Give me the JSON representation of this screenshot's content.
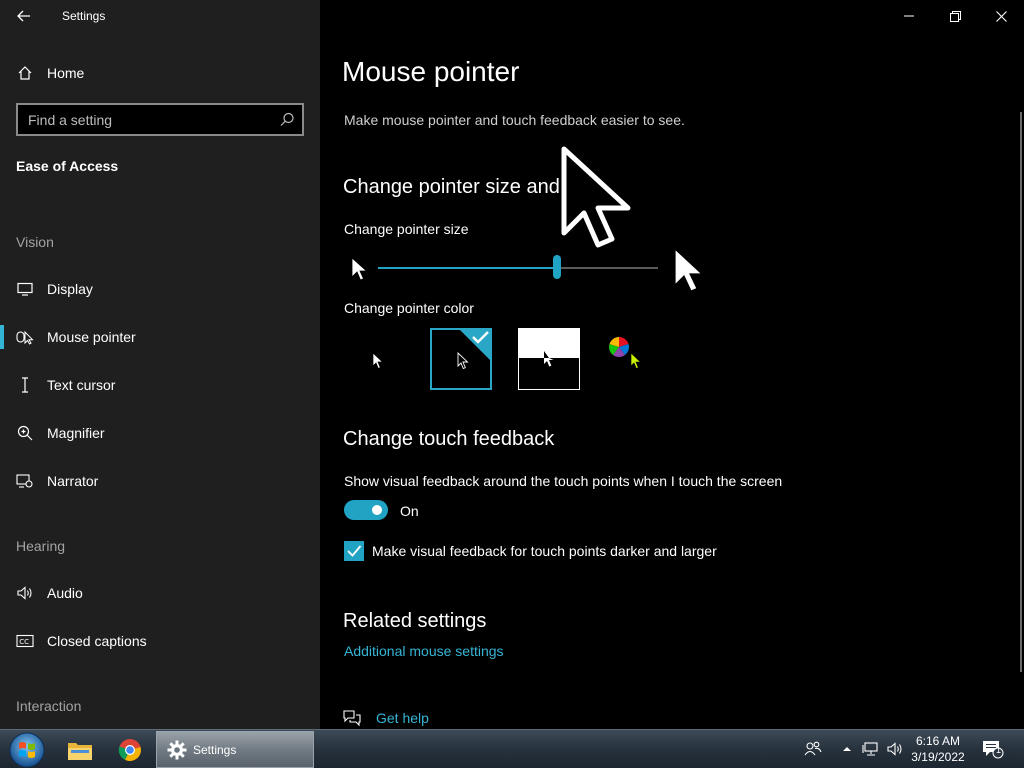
{
  "window": {
    "app_title": "Settings"
  },
  "sidebar": {
    "home_label": "Home",
    "search_placeholder": "Find a setting",
    "section_title": "Ease of Access",
    "groups": {
      "vision": "Vision",
      "hearing": "Hearing",
      "interaction": "Interaction"
    },
    "items": {
      "display": "Display",
      "mouse_pointer": "Mouse pointer",
      "text_cursor": "Text cursor",
      "magnifier": "Magnifier",
      "narrator": "Narrator",
      "audio": "Audio",
      "closed_captions": "Closed captions"
    },
    "selected": "Mouse pointer"
  },
  "main": {
    "title": "Mouse pointer",
    "description": "Make mouse pointer and touch feedback easier to see.",
    "size_color_heading": "Change pointer size and",
    "pointer_size_label": "Change pointer size",
    "pointer_size_value": 0.64,
    "pointer_color_label": "Change pointer color",
    "pointer_color_selected": 2,
    "touch_heading": "Change touch feedback",
    "touch_description": "Show visual feedback around the touch points when I touch the screen",
    "toggle_state": "On",
    "checkbox_label": "Make visual feedback for touch points darker and larger",
    "checkbox_checked": true,
    "related_heading": "Related settings",
    "related_link": "Additional mouse settings",
    "help_link": "Get help"
  },
  "taskbar": {
    "active_app": "Settings",
    "time": "6:16 AM",
    "date": "3/19/2022",
    "notification_count": "1"
  },
  "colors": {
    "accent": "#21a4c4",
    "link": "#35b5d6",
    "sidebar_bg": "#1f1f1f",
    "main_bg": "#000000"
  }
}
